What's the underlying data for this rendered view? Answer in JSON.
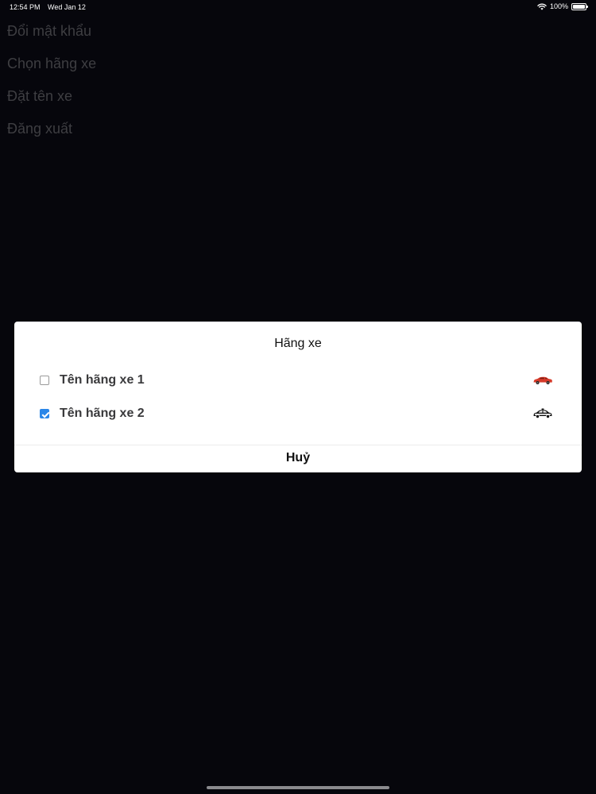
{
  "status_bar": {
    "time": "12:54 PM",
    "date": "Wed Jan 12",
    "battery_text": "100%",
    "battery_level": 1.0,
    "wifi_icon": "wifi-icon",
    "battery_icon": "battery-icon"
  },
  "menu": {
    "items": [
      {
        "label": "Đổi mật khẩu"
      },
      {
        "label": "Chọn hãng xe"
      },
      {
        "label": "Đặt tên xe"
      },
      {
        "label": "Đăng xuất"
      }
    ]
  },
  "dialog": {
    "title": "Hãng xe",
    "options": [
      {
        "label": "Tên hãng xe 1",
        "checked": false,
        "icon": "red-car-icon",
        "icon_color": "#d63b2a"
      },
      {
        "label": "Tên hãng xe 2",
        "checked": true,
        "icon": "police-car-icon",
        "icon_color": "#111111"
      }
    ],
    "cancel_label": "Huỷ"
  },
  "colors": {
    "background": "#06060c",
    "checkbox_accent": "#2a86e8"
  }
}
